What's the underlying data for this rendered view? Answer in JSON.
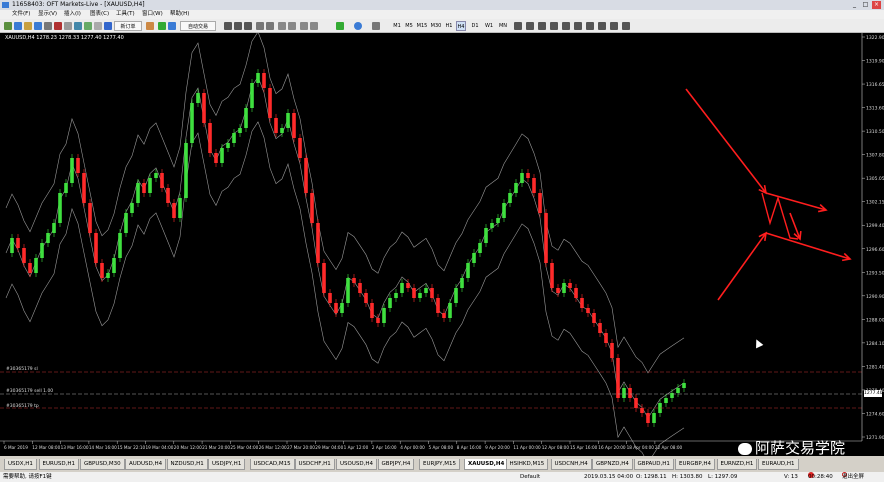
{
  "window": {
    "title": "11658403: OFT Markets-Live - [XAUUSD,H4]",
    "buttons": [
      "_",
      "□",
      "×"
    ]
  },
  "menu": [
    "文件(F)",
    "显示(V)",
    "插入(I)",
    "图表(C)",
    "工具(T)",
    "窗口(W)",
    "帮助(H)"
  ],
  "toolbar": {
    "new_order": "新订单",
    "autotrade": "自动交易",
    "timeframes": [
      "M1",
      "M5",
      "M15",
      "M30",
      "H1",
      "H4",
      "D1",
      "W1",
      "MN"
    ]
  },
  "chart": {
    "info": "XAUUSD,H4 1278.23 1278.33 1277.40 1277.40",
    "price_labels": [
      "1322.90",
      "1319.90",
      "1316.65",
      "1313.60",
      "1310.50",
      "1307.80",
      "1305.05",
      "1302.15",
      "1299.40",
      "1296.60",
      "1293.50",
      "1290.90",
      "1288.00",
      "1284.10",
      "1281.40",
      "1278.40",
      "1274.60",
      "1271.90"
    ],
    "time_labels": [
      "6 Mar 2019",
      "12 Mar 08:00",
      "13 Mar 16:00",
      "14 Mar 16:00",
      "15 Mar 22:10",
      "19 Mar 04:00",
      "20 Mar 12:00",
      "21 Mar 20:00",
      "25 Mar 04:00",
      "26 Mar 12:00",
      "27 Mar 20:00",
      "29 Mar 04:00",
      "1 Apr 12:00",
      "2 Apr 16:00",
      "4 Apr 00:00",
      "5 Apr 08:00",
      "8 Apr 16:00",
      "9 Apr 20:00",
      "11 Apr 00:00",
      "12 Apr 08:00",
      "15 Apr 16:00",
      "16 Apr 20:00",
      "18 Apr 04:00",
      "22 Apr 08:00"
    ],
    "order_lines": {
      "sl": "#30365179 sl",
      "sell": "#30365179 sell 1.00",
      "tp": "#30365179 tp"
    },
    "current_price": "1277.40"
  },
  "tabs": [
    "USDX,H1",
    "EURUSD,H1",
    "GBPUSD,M30",
    "AUDUSD,H4",
    "NZDUSD,H1",
    "USDJPY,H1",
    "USDCAD,M15",
    "USDCHF,H1",
    "USOUSD,H4",
    "GBPJPY,H4",
    "EURJPY,M15",
    "XAUUSD,H4",
    "HSIHKD,M15",
    "USDCNH,H4",
    "GBPNZD,H4",
    "GBPAUD,H1",
    "EURGBP,H4",
    "EURNZD,H1",
    "EURAUD,H1"
  ],
  "active_tab": "XAUUSD,H4",
  "status": {
    "help": "需要帮助, 请按F1键",
    "profile": "Default",
    "datetime": "2019.03.15 04:00",
    "open": "O: 1298.11",
    "high": "H: 1303.80",
    "low": "L: 1297.09",
    "volume": "V: 13",
    "connection": "00:28:40",
    "exit": "退出全屏"
  },
  "watermark": "阿萨交易学院"
}
